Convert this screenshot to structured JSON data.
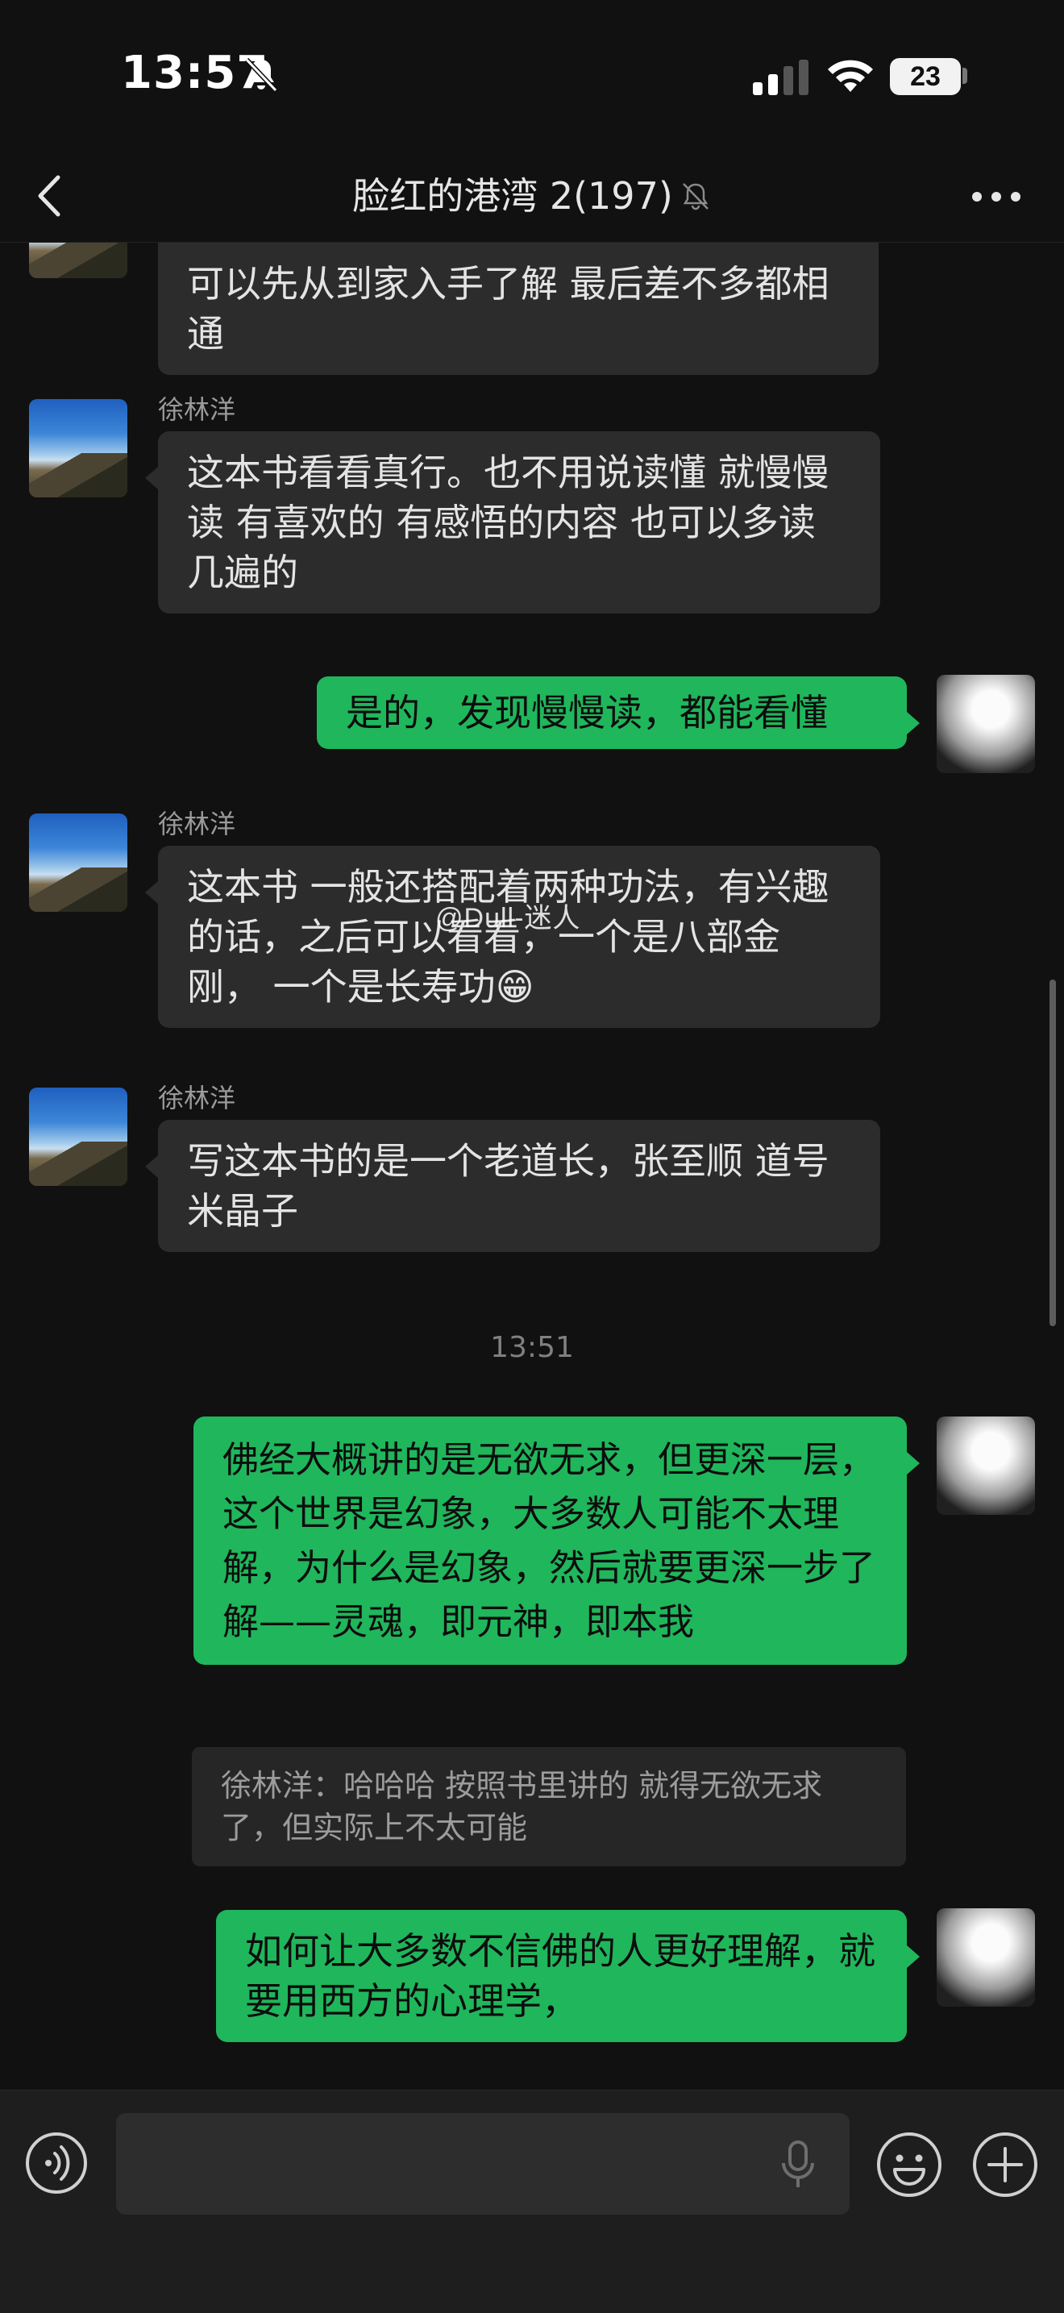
{
  "status_bar": {
    "time": "13:57",
    "battery": "23"
  },
  "header": {
    "title": "脸红的港湾 2(197)"
  },
  "messages": [
    {
      "text": "可以先从到家入手了解 最后差不多都相通"
    },
    {
      "sender": "徐林洋",
      "text": "这本书看看真行。也不用说读懂 就慢慢读 有喜欢的 有感悟的内容 也可以多读几遍的"
    },
    {
      "text": "是的，发现慢慢读，都能看懂"
    },
    {
      "sender": "徐林洋",
      "text": "这本书 一般还搭配着两种功法，有兴趣的话，之后可以看看，一个是八部金刚， 一个是长寿功😁"
    },
    {
      "sender": "徐林洋",
      "text": "写这本书的是一个老道长，张至顺 道号米晶子"
    },
    {
      "text": "佛经大概讲的是无欲无求，但更深一层，这个世界是幻象，大多数人可能不太理解，为什么是幻象，然后就要更深一步了解——灵魂，即元神，即本我"
    },
    {
      "text": "如何让大多数不信佛的人更好理解，就要用西方的心理学，"
    }
  ],
  "timestamp": "13:51",
  "quote": {
    "text": "徐林洋：哈哈哈 按照书里讲的 就得无欲无求了，但实际上不太可能"
  },
  "watermark": "@Dull-迷人",
  "input": {
    "value": ""
  },
  "colors": {
    "background": "#111111",
    "incoming_bubble": "#2c2c2c",
    "outgoing_bubble": "#20b65c",
    "input_bar": "#1e1e1e"
  },
  "icons": [
    "back-icon",
    "mute-icon",
    "more-icon",
    "voice-icon",
    "mic-icon",
    "emoji-icon",
    "plus-icon"
  ]
}
